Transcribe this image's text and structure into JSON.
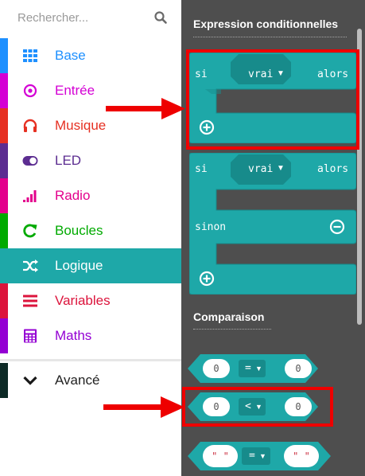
{
  "search": {
    "placeholder": "Rechercher..."
  },
  "toolbox": {
    "categories": [
      {
        "label": "Base",
        "color": "#1e90ff",
        "icon": "grid-icon"
      },
      {
        "label": "Entrée",
        "color": "#d400d4",
        "icon": "target-icon"
      },
      {
        "label": "Musique",
        "color": "#e63022",
        "icon": "headphones-icon"
      },
      {
        "label": "LED",
        "color": "#5c2d91",
        "icon": "toggle-icon"
      },
      {
        "label": "Radio",
        "color": "#e3008c",
        "icon": "signal-bars-icon"
      },
      {
        "label": "Boucles",
        "color": "#00aa00",
        "icon": "refresh-icon"
      },
      {
        "label": "Logique",
        "color": "#00a4a6",
        "icon": "shuffle-icon"
      },
      {
        "label": "Variables",
        "color": "#dc143c",
        "icon": "list-icon"
      },
      {
        "label": "Maths",
        "color": "#9400d3",
        "icon": "calculator-icon"
      },
      {
        "label": "Avancé",
        "color": "#222222",
        "icon": "chevron-down-icon"
      }
    ],
    "active": "Logique"
  },
  "flyout": {
    "section_conditional": "Expression conditionnelles",
    "section_comparison": "Comparaison",
    "if_block": {
      "si": "si",
      "value": "vrai",
      "alors": "alors"
    },
    "if_else_block": {
      "si": "si",
      "value": "vrai",
      "alors": "alors",
      "sinon": "sinon"
    },
    "compare_blocks": [
      {
        "left": "0",
        "op": "=",
        "right": "0"
      },
      {
        "left": "0",
        "op": "<",
        "right": "0"
      },
      {
        "left": "\" \"",
        "op": "=",
        "right": "\" \""
      }
    ],
    "block_color": "#1ea8a8",
    "block_dark": "#178b8b"
  },
  "annotations": {
    "highlight_color": "#ee0000"
  }
}
